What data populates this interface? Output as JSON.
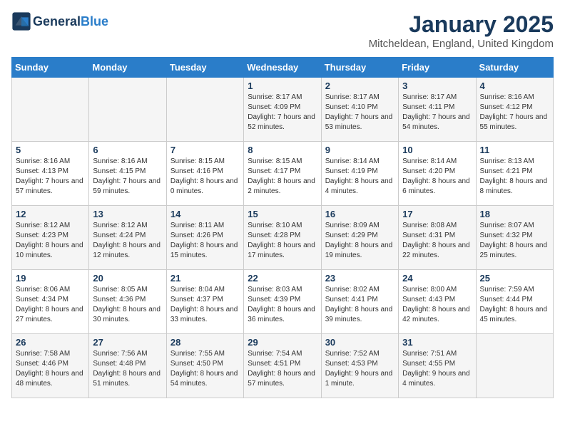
{
  "header": {
    "logo_general": "General",
    "logo_blue": "Blue",
    "title": "January 2025",
    "subtitle": "Mitcheldean, England, United Kingdom"
  },
  "days_of_week": [
    "Sunday",
    "Monday",
    "Tuesday",
    "Wednesday",
    "Thursday",
    "Friday",
    "Saturday"
  ],
  "weeks": [
    [
      {
        "day": "",
        "content": ""
      },
      {
        "day": "",
        "content": ""
      },
      {
        "day": "",
        "content": ""
      },
      {
        "day": "1",
        "content": "Sunrise: 8:17 AM\nSunset: 4:09 PM\nDaylight: 7 hours and 52 minutes."
      },
      {
        "day": "2",
        "content": "Sunrise: 8:17 AM\nSunset: 4:10 PM\nDaylight: 7 hours and 53 minutes."
      },
      {
        "day": "3",
        "content": "Sunrise: 8:17 AM\nSunset: 4:11 PM\nDaylight: 7 hours and 54 minutes."
      },
      {
        "day": "4",
        "content": "Sunrise: 8:16 AM\nSunset: 4:12 PM\nDaylight: 7 hours and 55 minutes."
      }
    ],
    [
      {
        "day": "5",
        "content": "Sunrise: 8:16 AM\nSunset: 4:13 PM\nDaylight: 7 hours and 57 minutes."
      },
      {
        "day": "6",
        "content": "Sunrise: 8:16 AM\nSunset: 4:15 PM\nDaylight: 7 hours and 59 minutes."
      },
      {
        "day": "7",
        "content": "Sunrise: 8:15 AM\nSunset: 4:16 PM\nDaylight: 8 hours and 0 minutes."
      },
      {
        "day": "8",
        "content": "Sunrise: 8:15 AM\nSunset: 4:17 PM\nDaylight: 8 hours and 2 minutes."
      },
      {
        "day": "9",
        "content": "Sunrise: 8:14 AM\nSunset: 4:19 PM\nDaylight: 8 hours and 4 minutes."
      },
      {
        "day": "10",
        "content": "Sunrise: 8:14 AM\nSunset: 4:20 PM\nDaylight: 8 hours and 6 minutes."
      },
      {
        "day": "11",
        "content": "Sunrise: 8:13 AM\nSunset: 4:21 PM\nDaylight: 8 hours and 8 minutes."
      }
    ],
    [
      {
        "day": "12",
        "content": "Sunrise: 8:12 AM\nSunset: 4:23 PM\nDaylight: 8 hours and 10 minutes."
      },
      {
        "day": "13",
        "content": "Sunrise: 8:12 AM\nSunset: 4:24 PM\nDaylight: 8 hours and 12 minutes."
      },
      {
        "day": "14",
        "content": "Sunrise: 8:11 AM\nSunset: 4:26 PM\nDaylight: 8 hours and 15 minutes."
      },
      {
        "day": "15",
        "content": "Sunrise: 8:10 AM\nSunset: 4:28 PM\nDaylight: 8 hours and 17 minutes."
      },
      {
        "day": "16",
        "content": "Sunrise: 8:09 AM\nSunset: 4:29 PM\nDaylight: 8 hours and 19 minutes."
      },
      {
        "day": "17",
        "content": "Sunrise: 8:08 AM\nSunset: 4:31 PM\nDaylight: 8 hours and 22 minutes."
      },
      {
        "day": "18",
        "content": "Sunrise: 8:07 AM\nSunset: 4:32 PM\nDaylight: 8 hours and 25 minutes."
      }
    ],
    [
      {
        "day": "19",
        "content": "Sunrise: 8:06 AM\nSunset: 4:34 PM\nDaylight: 8 hours and 27 minutes."
      },
      {
        "day": "20",
        "content": "Sunrise: 8:05 AM\nSunset: 4:36 PM\nDaylight: 8 hours and 30 minutes."
      },
      {
        "day": "21",
        "content": "Sunrise: 8:04 AM\nSunset: 4:37 PM\nDaylight: 8 hours and 33 minutes."
      },
      {
        "day": "22",
        "content": "Sunrise: 8:03 AM\nSunset: 4:39 PM\nDaylight: 8 hours and 36 minutes."
      },
      {
        "day": "23",
        "content": "Sunrise: 8:02 AM\nSunset: 4:41 PM\nDaylight: 8 hours and 39 minutes."
      },
      {
        "day": "24",
        "content": "Sunrise: 8:00 AM\nSunset: 4:43 PM\nDaylight: 8 hours and 42 minutes."
      },
      {
        "day": "25",
        "content": "Sunrise: 7:59 AM\nSunset: 4:44 PM\nDaylight: 8 hours and 45 minutes."
      }
    ],
    [
      {
        "day": "26",
        "content": "Sunrise: 7:58 AM\nSunset: 4:46 PM\nDaylight: 8 hours and 48 minutes."
      },
      {
        "day": "27",
        "content": "Sunrise: 7:56 AM\nSunset: 4:48 PM\nDaylight: 8 hours and 51 minutes."
      },
      {
        "day": "28",
        "content": "Sunrise: 7:55 AM\nSunset: 4:50 PM\nDaylight: 8 hours and 54 minutes."
      },
      {
        "day": "29",
        "content": "Sunrise: 7:54 AM\nSunset: 4:51 PM\nDaylight: 8 hours and 57 minutes."
      },
      {
        "day": "30",
        "content": "Sunrise: 7:52 AM\nSunset: 4:53 PM\nDaylight: 9 hours and 1 minute."
      },
      {
        "day": "31",
        "content": "Sunrise: 7:51 AM\nSunset: 4:55 PM\nDaylight: 9 hours and 4 minutes."
      },
      {
        "day": "",
        "content": ""
      }
    ]
  ]
}
